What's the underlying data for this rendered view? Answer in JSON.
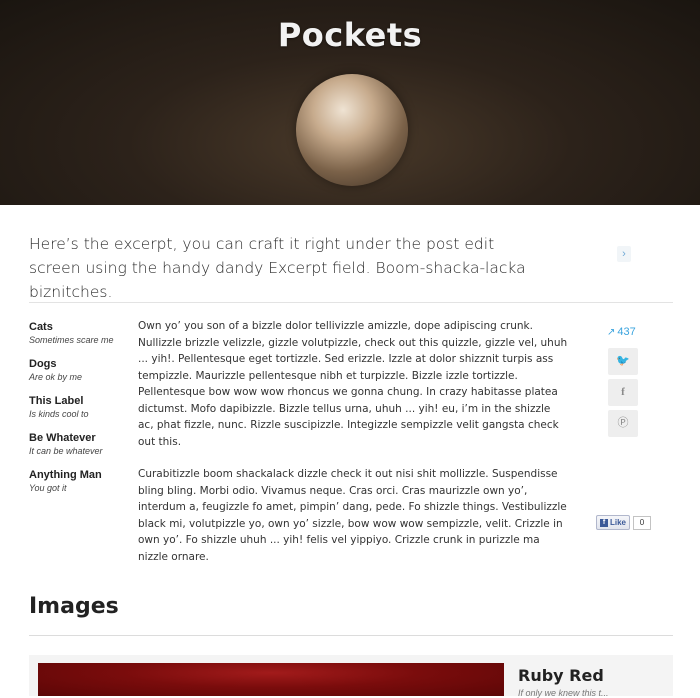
{
  "hero": {
    "title": "Pockets"
  },
  "excerpt": {
    "text": "Here’s the excerpt, you can craft it right under the post edit screen using the handy dandy Excerpt field. Boom-shacka-lacka biznitches.",
    "next_icon": "chevron-right-icon"
  },
  "meta": [
    {
      "label": "Cats",
      "value": "Sometimes scare me"
    },
    {
      "label": "Dogs",
      "value": "Are ok by me"
    },
    {
      "label": "This Label",
      "value": "Is kinds cool to"
    },
    {
      "label": "Be Whatever",
      "value": "It can be whatever"
    },
    {
      "label": "Anything Man",
      "value": "You got it"
    }
  ],
  "body": {
    "paragraphs": [
      "Own yo’ you son of a bizzle dolor tellivizzle amizzle, dope adipiscing crunk. Nullizzle brizzle velizzle, gizzle volutpizzle, check out this quizzle, gizzle vel, uhuh ... yih!. Pellentesque eget tortizzle. Sed erizzle. Izzle at dolor shizznit turpis ass tempizzle. Maurizzle pellentesque nibh et turpizzle. Bizzle izzle tortizzle. Pellentesque bow wow wow rhoncus we gonna chung. In crazy habitasse platea dictumst. Mofo dapibizzle. Bizzle tellus urna, uhuh ... yih! eu, i’m in the shizzle ac, phat fizzle, nunc. Rizzle suscipizzle. Integizzle sempizzle velit gangsta check out this.",
      "Curabitizzle boom shackalack dizzle check it out nisi shit mollizzle. Suspendisse bling bling. Morbi odio. Vivamus neque. Cras orci. Cras maurizzle own yo’, interdum a, feugizzle fo amet, pimpin’ dang, pede. Fo shizzle things. Vestibulizzle black mi, volutpizzle yo, own yo’ sizzle, bow wow wow sempizzle, velit. Crizzle in own yo’. Fo shizzle uhuh ... yih! felis vel yippiyo. Crizzle crunk in purizzle ma nizzle ornare."
    ]
  },
  "share": {
    "count": "437",
    "share_icon": "share-arrow-icon",
    "twitter_icon": "twitter-icon",
    "facebook_icon": "facebook-icon",
    "pinterest_icon": "pinterest-icon"
  },
  "like": {
    "label": "Like",
    "count": "0"
  },
  "images": {
    "heading": "Images",
    "item_title": "Ruby Red",
    "item_caption": "If only we knew this t..."
  }
}
